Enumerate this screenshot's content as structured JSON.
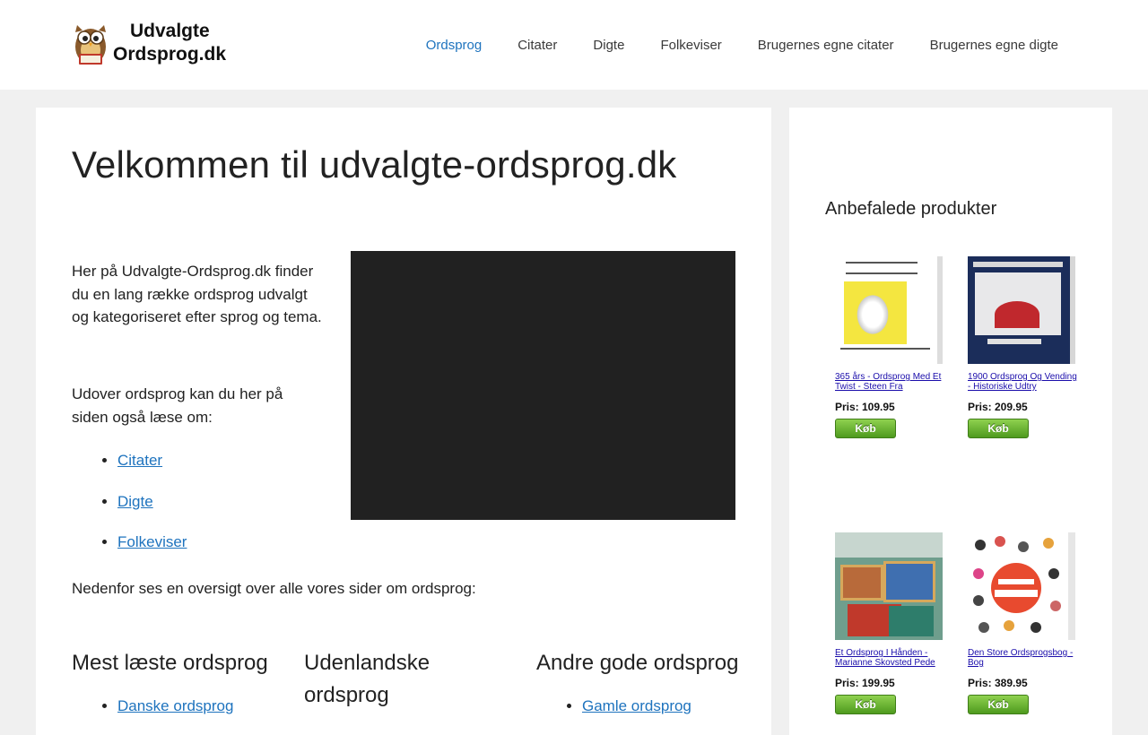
{
  "header": {
    "logo": {
      "line1": "Udvalgte",
      "line2": "Ordsprog.dk"
    },
    "nav": [
      {
        "label": "Ordsprog",
        "active": true
      },
      {
        "label": "Citater"
      },
      {
        "label": "Digte"
      },
      {
        "label": "Folkeviser"
      },
      {
        "label": "Brugernes egne citater"
      },
      {
        "label": "Brugernes egne digte"
      }
    ]
  },
  "main": {
    "title": "Velkommen til udvalgte-ordsprog.dk",
    "intro": "Her på Udvalgte-Ordsprog.dk finder du en lang række ordsprog udvalgt og kategoriseret efter sprog og tema.",
    "intro2": "Udover ordsprog kan du her på siden også læse om:",
    "links": [
      "Citater",
      "Digte",
      "Folkeviser"
    ],
    "overview": "Nedenfor ses en oversigt over alle vores sider om ordsprog:",
    "columns": [
      {
        "title": "Mest læste ordsprog",
        "items": [
          "Danske ordsprog"
        ]
      },
      {
        "title": "Udenlandske ordsprog",
        "items": []
      },
      {
        "title": "Andre gode ordsprog",
        "items": [
          "Gamle ordsprog"
        ]
      }
    ]
  },
  "sidebar": {
    "title": "Anbefalede produkter",
    "buy_label": "Køb",
    "products": [
      {
        "name": "365 års - Ordsprog Med Et Twist - Steen Fra",
        "price": "Pris: 109.95"
      },
      {
        "name": "1900 Ordsprog Og Vending - Historiske Udtry",
        "price": "Pris: 209.95"
      },
      {
        "name": "Et Ordsprog I Hånden - Marianne Skovsted Pede",
        "price": "Pris: 199.95"
      },
      {
        "name": "Den Store Ordsprogsbog - Bog",
        "price": "Pris: 389.95"
      }
    ]
  },
  "colors": {
    "accent": "#1e73be",
    "background": "#f0f0f0",
    "video": "#212121",
    "buy": "#5aac2a"
  }
}
